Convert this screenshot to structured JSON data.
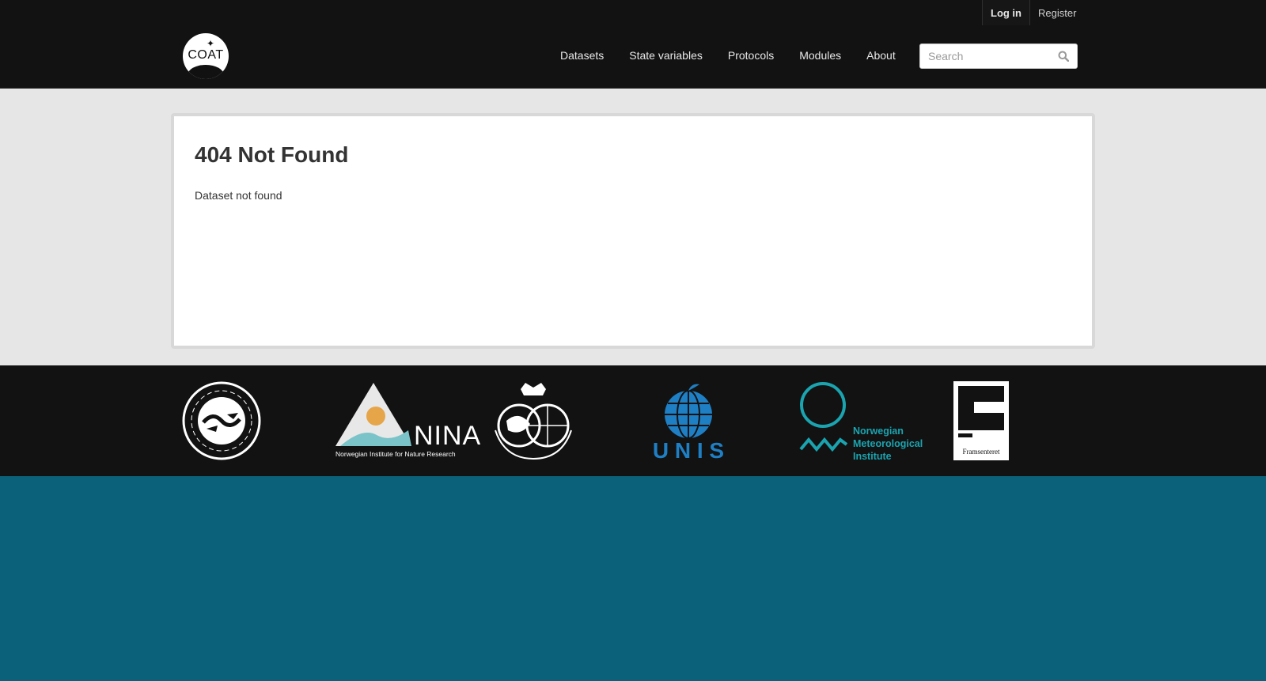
{
  "header": {
    "account": {
      "login_label": "Log in",
      "register_label": "Register"
    },
    "logo_text": "COAT",
    "nav": [
      {
        "label": "Datasets"
      },
      {
        "label": "State variables"
      },
      {
        "label": "Protocols"
      },
      {
        "label": "Modules"
      },
      {
        "label": "About"
      }
    ],
    "search": {
      "placeholder": "Search",
      "value": ""
    }
  },
  "main": {
    "title": "404 Not Found",
    "message": "Dataset not found"
  },
  "partners": {
    "nina": {
      "name": "NINA",
      "subtitle": "Norwegian Institute for Nature Research"
    },
    "unis": {
      "name": "U N I S"
    },
    "met": {
      "line1": "Norwegian",
      "line2": "Meteorological",
      "line3": "Institute"
    },
    "fram": {
      "name": "Framsenteret"
    }
  },
  "colors": {
    "header_bg": "#121212",
    "page_bg": "#e6e6e6",
    "footer_bg": "#0b6179",
    "unis_blue": "#1f7fc4",
    "met_teal": "#1aa4b0",
    "nina_teal": "#7ac3c8",
    "nina_orange": "#e6a548"
  }
}
